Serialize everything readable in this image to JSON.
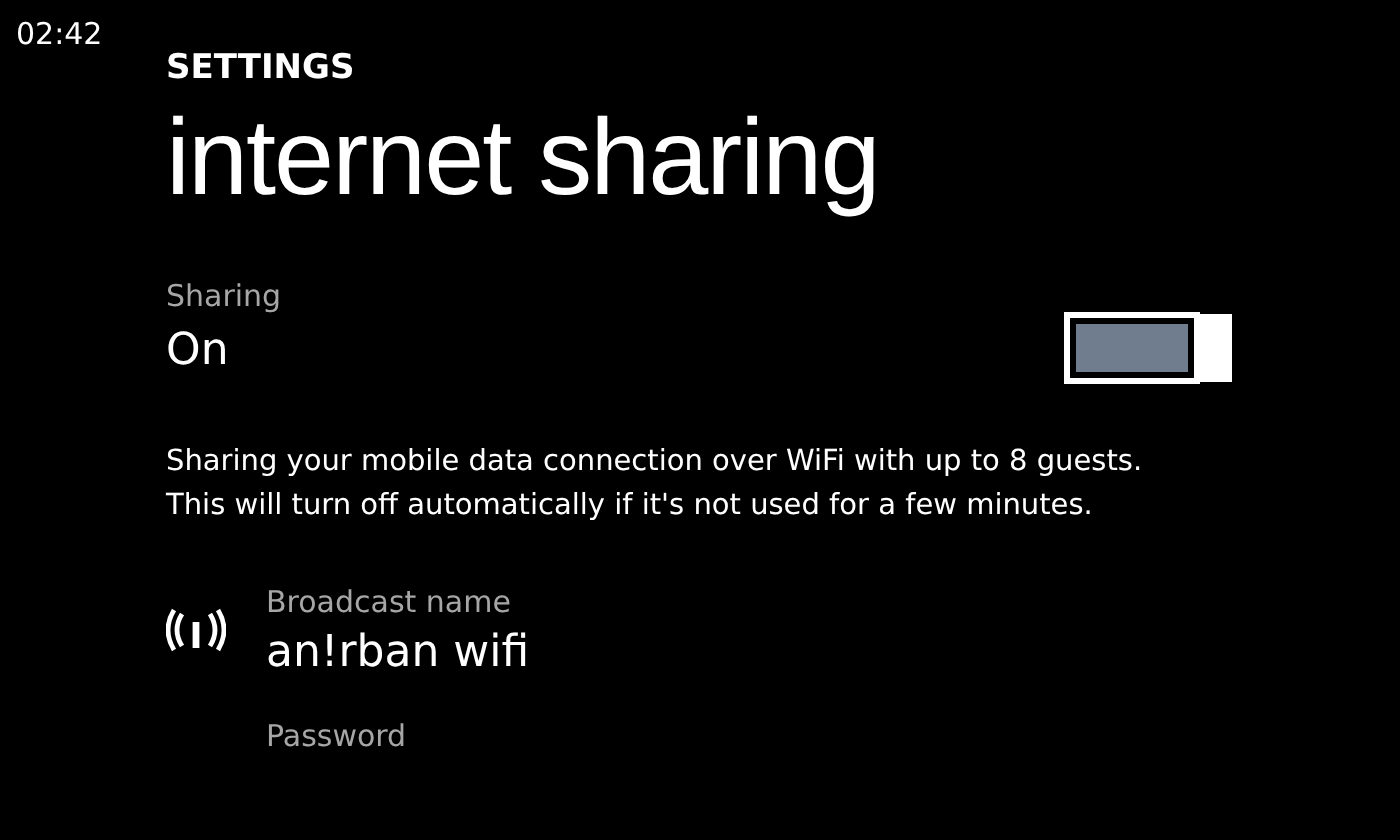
{
  "status_bar": {
    "time": "02:42"
  },
  "header": {
    "app_title": "SETTINGS",
    "page_title": "internet sharing"
  },
  "sharing": {
    "label": "Sharing",
    "value": "On",
    "on": true
  },
  "description": [
    "Sharing your mobile data connection over WiFi with up to 8 guests.",
    "This will turn off automatically if it's not used for a few minutes."
  ],
  "broadcast_name": {
    "label": "Broadcast name",
    "value": "an!rban wifi"
  },
  "password": {
    "label": "Password"
  }
}
